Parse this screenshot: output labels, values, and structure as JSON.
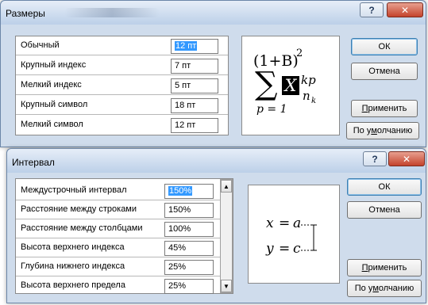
{
  "razmery": {
    "title": "Размеры",
    "rows": [
      {
        "label": "Обычный",
        "value": "12 пт"
      },
      {
        "label": "Крупный индекс",
        "value": "7 пт"
      },
      {
        "label": "Мелкий индекс",
        "value": "5 пт"
      },
      {
        "label": "Крупный символ",
        "value": "18 пт"
      },
      {
        "label": "Мелкий символ",
        "value": "12 пт"
      }
    ],
    "buttons": {
      "ok": "ОК",
      "cancel": "Отмена",
      "apply_u": "П",
      "apply_rest": "рименить",
      "default_a": "По у",
      "default_u": "м",
      "default_b": "олчанию"
    },
    "preview": {
      "base": "(1+B)",
      "exp": "2",
      "sigma": "∑",
      "X": "X",
      "sup": "kp",
      "sub_n": "n",
      "sub_k": "k",
      "lower": "p = 1"
    }
  },
  "interval": {
    "title": "Интервал",
    "rows": [
      {
        "label": "Междустрочный интервал",
        "value": "150%"
      },
      {
        "label": "Расстояние между строками",
        "value": "150%"
      },
      {
        "label": "Расстояние между столбцами",
        "value": "100%"
      },
      {
        "label": "Высота верхнего индекса",
        "value": "45%"
      },
      {
        "label": "Глубина нижнего индекса",
        "value": "25%"
      },
      {
        "label": "Высота верхнего предела",
        "value": "25%"
      }
    ],
    "buttons": {
      "ok": "ОК",
      "cancel": "Отмена",
      "apply_u": "П",
      "apply_rest": "рименить",
      "default_a": "По у",
      "default_u": "м",
      "default_b": "олчанию"
    },
    "preview": {
      "line1_a": "x",
      "line1_eq": "=",
      "line1_b": "a",
      "line2_a": "y",
      "line2_eq": "=",
      "line2_b": "c"
    }
  },
  "controls": {
    "help": "?",
    "close": "✕"
  }
}
